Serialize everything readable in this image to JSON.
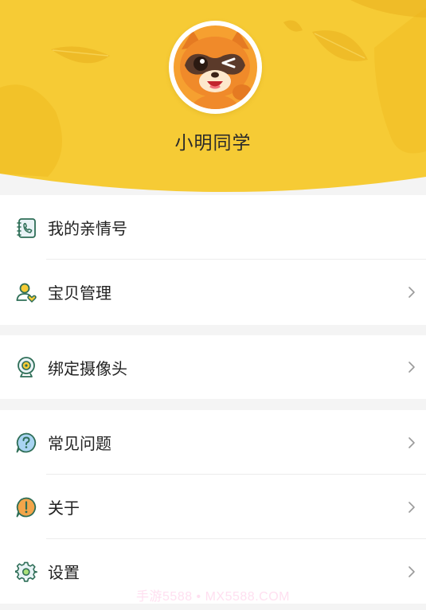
{
  "profile": {
    "name": "小明同学",
    "avatar_icon": "raccoon-mascot-avatar"
  },
  "menu": {
    "family_number": {
      "label": "我的亲情号",
      "icon": "phone-book-icon",
      "has_chevron": false
    },
    "baby_manage": {
      "label": "宝贝管理",
      "icon": "user-heart-icon",
      "has_chevron": true
    },
    "bind_camera": {
      "label": "绑定摄像头",
      "icon": "webcam-icon",
      "has_chevron": true
    },
    "faq": {
      "label": "常见问题",
      "icon": "question-bubble-icon",
      "has_chevron": true
    },
    "about": {
      "label": "关于",
      "icon": "exclamation-bubble-icon",
      "has_chevron": true
    },
    "settings": {
      "label": "设置",
      "icon": "gear-icon",
      "has_chevron": true
    }
  },
  "watermark": "手游5588 • MX5588.COM",
  "colors": {
    "header_yellow": "#f6cb35",
    "icon_green": "#2e6e57",
    "page_bg": "#f4f4f4"
  }
}
